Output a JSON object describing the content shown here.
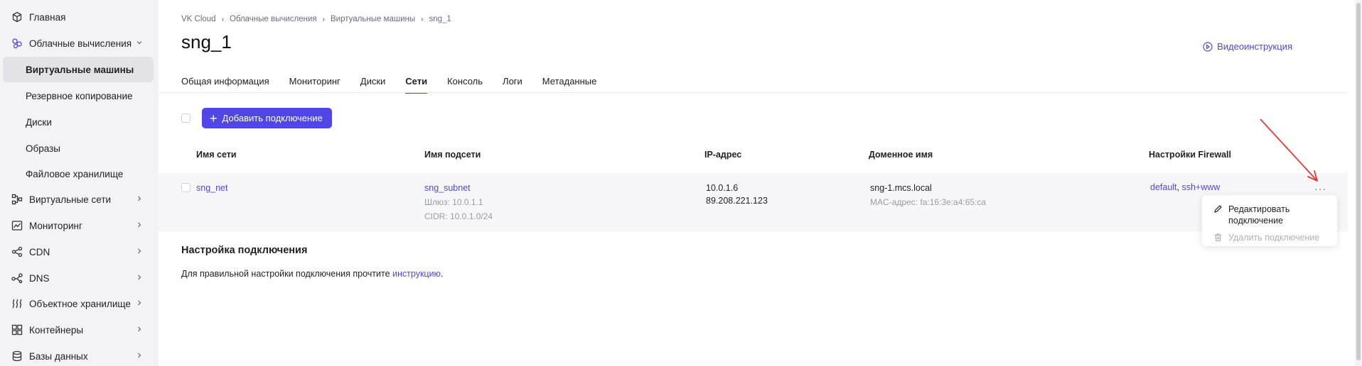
{
  "sidebar": {
    "items": [
      {
        "label": "Главная",
        "icon": "cube-icon"
      },
      {
        "label": "Облачные вычисления",
        "icon": "cloud-compute-icon"
      },
      {
        "label": "Виртуальные машины"
      },
      {
        "label": "Резервное копирование"
      },
      {
        "label": "Диски"
      },
      {
        "label": "Образы"
      },
      {
        "label": "Файловое хранилище"
      },
      {
        "label": "Виртуальные сети",
        "icon": "network-icon"
      },
      {
        "label": "Мониторинг",
        "icon": "monitoring-icon"
      },
      {
        "label": "CDN",
        "icon": "share-icon"
      },
      {
        "label": "DNS",
        "icon": "dns-icon"
      },
      {
        "label": "Объектное хранилище",
        "icon": "object-storage-icon"
      },
      {
        "label": "Контейнеры",
        "icon": "containers-icon"
      },
      {
        "label": "Базы данных",
        "icon": "database-icon"
      }
    ]
  },
  "breadcrumb": [
    "VK Cloud",
    "Облачные вычисления",
    "Виртуальные машины",
    "sng_1"
  ],
  "page_title": "sng_1",
  "video_link": "Видеоинструкция",
  "tabs": [
    "Общая информация",
    "Мониторинг",
    "Диски",
    "Сети",
    "Консоль",
    "Логи",
    "Метаданные"
  ],
  "active_tab": "Сети",
  "add_button": "Добавить подключение",
  "table": {
    "headers": [
      "Имя сети",
      "Имя подсети",
      "IP-адрес",
      "Доменное имя",
      "Настройки Firewall"
    ],
    "row": {
      "network": "sng_net",
      "subnet": "sng_subnet",
      "gateway": "Шлюз: 10.0.1.1",
      "cidr": "CIDR: 10.0.1.0/24",
      "ip_private": "10.0.1.6",
      "ip_public": "89.208.221.123",
      "domain": "sng-1.mcs.local",
      "mac": "MAC-адрес: fa:16:3e:a4:65:ca",
      "firewall_1": "default",
      "firewall_sep": ", ",
      "firewall_2": "ssh+www"
    }
  },
  "row_menu": {
    "edit_line1": "Редактировать",
    "edit_line2": "подключение",
    "delete": "Удалить подключение"
  },
  "connection_section": {
    "title": "Настройка подключения",
    "text": "Для правильной настройки подключения прочтите ",
    "link": "инструкцию",
    "end": "."
  },
  "colors": {
    "accent": "#4f46e5",
    "annotation": "#e53935"
  }
}
